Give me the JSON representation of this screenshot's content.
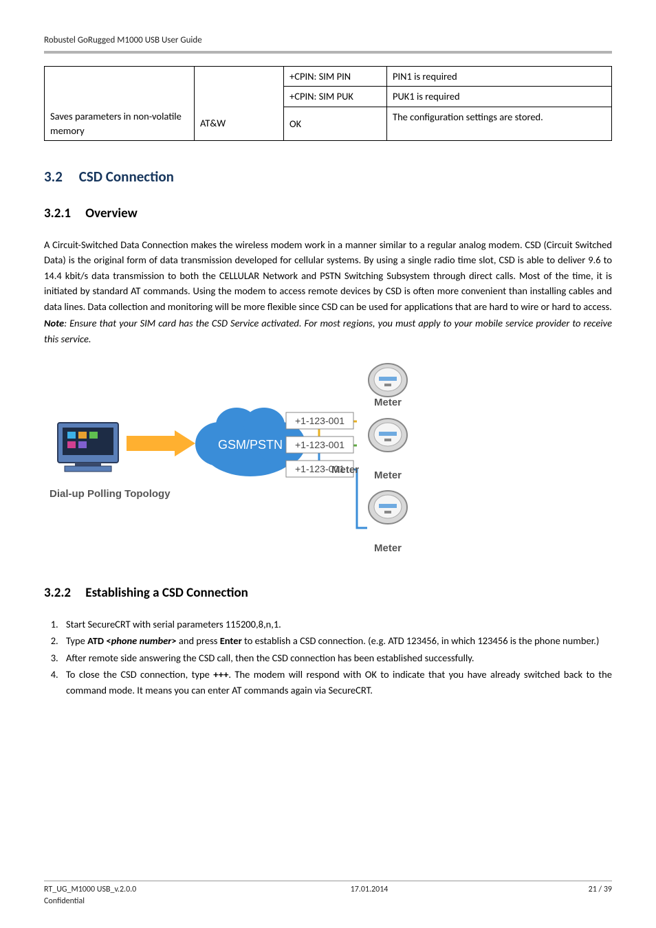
{
  "header": {
    "title": "Robustel GoRugged M1000 USB User Guide"
  },
  "table": {
    "rows": [
      {
        "c1": "",
        "c2": "",
        "c3": "+CPIN: SIM PIN",
        "c4": "PIN1 is required"
      },
      {
        "c1": "",
        "c2": "",
        "c3": "+CPIN: SIM PUK",
        "c4": "PUK1 is required"
      },
      {
        "c1": "Saves parameters in non-volatile memory",
        "c2": "AT&W",
        "c3": "OK",
        "c4": "The configuration settings are stored."
      }
    ]
  },
  "h2": {
    "num": "3.2",
    "title": "CSD Connection"
  },
  "h3a": {
    "num": "3.2.1",
    "title": "Overview"
  },
  "overview": {
    "p1": "A Circuit-Switched Data Connection makes the wireless modem work in a manner similar to a regular analog modem. CSD (Circuit Switched Data) is the original form of data transmission developed for cellular systems. By using a single radio time slot, CSD is able to deliver 9.6 to 14.4 kbit/s data transmission to both the CELLULAR Network and PSTN Switching Subsystem through direct calls. Most of the time, it is initiated by standard AT commands. Using the modem to access remote devices by CSD is often more convenient than installing cables and data lines. Data collection and monitoring will be more flexible since CSD can be used for applications that are hard to wire or hard to access.",
    "note_label": "Note",
    "note_body": ": Ensure that your SIM card has the CSD Service activated. For most regions, you must apply to your mobile service provider to receive this service."
  },
  "diagram": {
    "topology_label": "Dial-up Polling Topology",
    "cloud_label": "GSM/PSTN",
    "dial1": "+1-123-001",
    "dial2": "+1-123-001",
    "dial3": "+1-123-001",
    "meter1": "Meter",
    "meter2": "Meter",
    "meter3": "Meter"
  },
  "h3b": {
    "num": "3.2.2",
    "title": "Establishing a CSD Connection"
  },
  "steps": {
    "s1": "Start SecureCRT with serial parameters 115200,8,n,1.",
    "s2a": "Type ",
    "s2b": "ATD <",
    "s2c": "phone number",
    "s2d": ">",
    "s2e": " and press ",
    "s2f": "Enter",
    "s2g": " to establish a CSD connection. (e.g. ATD 123456, in which 123456 is the phone number.)",
    "s3": "After remote side answering the CSD call, then the CSD connection has been established successfully.",
    "s4a": "To close the CSD connection, type ",
    "s4b": "+++",
    "s4c": ". The modem will respond with OK to indicate that you have already switched back to the command mode. It means you can enter AT commands again via SecureCRT."
  },
  "footer": {
    "left": "RT_UG_M1000 USB_v.2.0.0",
    "mid": "17.01.2014",
    "right": "21 / 39",
    "second": "Confidential"
  }
}
